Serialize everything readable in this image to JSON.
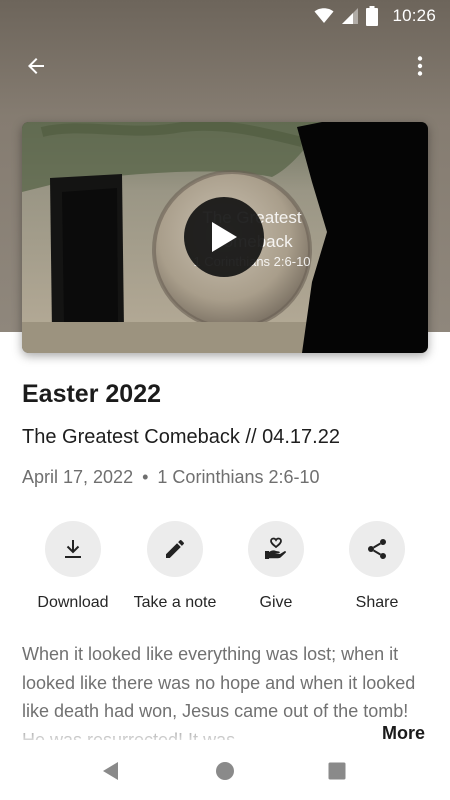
{
  "status_bar": {
    "time": "10:26",
    "icons": [
      "wifi-icon",
      "cellular-signal-icon",
      "battery-icon"
    ]
  },
  "top_bar": {
    "back_icon": "arrow-left-icon",
    "menu_icon": "more-vertical-icon"
  },
  "video": {
    "overlay_title_line1": "The Greatest",
    "overlay_title_line2": "Comeback",
    "overlay_reference": "1 Corinthians 2:6-10",
    "play_icon": "play-icon"
  },
  "sermon": {
    "series": "Easter 2022",
    "title": "The Greatest Comeback // 04.17.22",
    "date": "April 17, 2022",
    "separator": "•",
    "scripture": "1 Corinthians 2:6-10"
  },
  "actions": [
    {
      "label": "Download",
      "icon": "download-icon"
    },
    {
      "label": "Take a note",
      "icon": "pencil-icon"
    },
    {
      "label": "Give",
      "icon": "give-hand-heart-icon"
    },
    {
      "label": "Share",
      "icon": "share-icon"
    }
  ],
  "description": {
    "text": "When it looked like everything was lost; when it looked like there was no hope and when it looked like death had won, Jesus came out of the tomb! He was resurrected! It was",
    "more_label": "More"
  },
  "nav_bar": {
    "icons": [
      "back-triangle-icon",
      "home-circle-icon",
      "recents-square-icon"
    ]
  },
  "colors": {
    "header_background": "#857c71",
    "action_circle": "#ececec",
    "description_text": "#717171"
  }
}
